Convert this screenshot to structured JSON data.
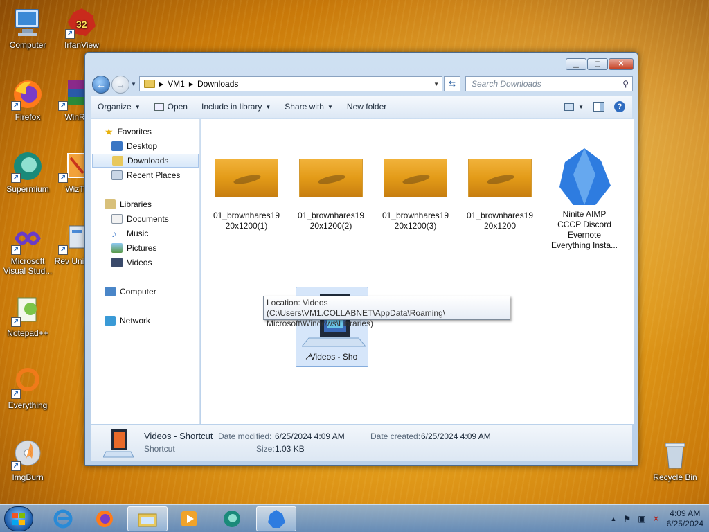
{
  "desktop": {
    "icons": [
      {
        "label": "Computer"
      },
      {
        "label": "IrfanView"
      },
      {
        "label": "Firefox"
      },
      {
        "label": "WinR"
      },
      {
        "label": "Supermium"
      },
      {
        "label": "WizT"
      },
      {
        "label": "Microsoft Visual Stud..."
      },
      {
        "label": "Rev Uninst"
      },
      {
        "label": "Notepad++"
      },
      {
        "label": "Everything"
      },
      {
        "label": "ImgBurn"
      },
      {
        "label": "Recycle Bin"
      }
    ],
    "irfanview_badge": "32"
  },
  "window": {
    "controls": {
      "minimize": "▁",
      "maximize": "▢",
      "close": "✕"
    },
    "nav": {
      "back": "←",
      "forward": "→"
    },
    "address": {
      "crumbs": [
        "VM1",
        "Downloads"
      ],
      "separator": "▶",
      "dropdown": "▼",
      "refresh": "⇆"
    },
    "search": {
      "placeholder": "Search Downloads",
      "icon": "search-icon"
    },
    "toolbar": {
      "organize": "Organize",
      "open": "Open",
      "include_in_library": "Include in library",
      "share_with": "Share with",
      "new_folder": "New folder",
      "dropdown_arrow": "▼",
      "help": "?"
    },
    "navpane": {
      "favorites": "Favorites",
      "desktop": "Desktop",
      "downloads": "Downloads",
      "recent_places": "Recent Places",
      "libraries": "Libraries",
      "documents": "Documents",
      "music": "Music",
      "pictures": "Pictures",
      "videos": "Videos",
      "computer": "Computer",
      "network": "Network"
    },
    "files": [
      {
        "name": "01_brownhares19\n20x1200(1)"
      },
      {
        "name": "01_brownhares19\n20x1200(2)"
      },
      {
        "name": "01_brownhares19\n20x1200(3)"
      },
      {
        "name": "01_brownhares19\n20x1200"
      },
      {
        "name": "Ninite AIMP\nCCCP Discord\nEvernote\nEverything Insta..."
      },
      {
        "name": "Videos - Sho"
      }
    ],
    "tooltip": "Location: Videos (C:\\Users\\VM1.COLLABNET\\AppData\\Roaming\\\nMicrosoft\\Windows\\Libraries)",
    "details": {
      "name": "Videos - Shortcut",
      "type": "Shortcut",
      "date_modified_label": "Date modified:",
      "date_modified": "6/25/2024 4:09 AM",
      "date_created_label": "Date created:",
      "date_created": "6/25/2024 4:09 AM",
      "size_label": "Size:",
      "size": "1.03 KB"
    }
  },
  "taskbar": {
    "apps": [
      "internet-explorer",
      "firefox",
      "windows-explorer",
      "media-player",
      "supermium",
      "ninite"
    ],
    "tray": {
      "overflow": "▲",
      "time": "4:09 AM",
      "date": "6/25/2024"
    }
  },
  "colors": {
    "accent": "#2f6cc0",
    "desktop_orange": "#e9a51f"
  }
}
